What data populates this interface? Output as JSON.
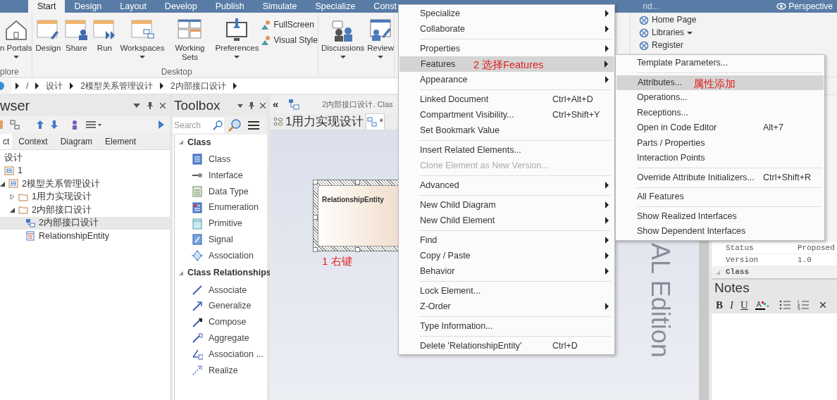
{
  "ribbon": {
    "tabs": [
      {
        "label": "Start",
        "selected": true
      },
      {
        "label": "Design",
        "selected": false
      },
      {
        "label": "Layout",
        "selected": false
      },
      {
        "label": "Develop",
        "selected": false
      },
      {
        "label": "Publish",
        "selected": false
      },
      {
        "label": "Simulate",
        "selected": false
      },
      {
        "label": "Specialize",
        "selected": false
      },
      {
        "label": "Const",
        "selected": false
      }
    ],
    "search": {
      "placeholder": "nd..."
    },
    "perspective": "Perspective",
    "groups": [
      {
        "label": "plore",
        "buttons": [
          {
            "label": "n Portals",
            "dropdown": true
          }
        ]
      },
      {
        "label": "Desktop",
        "buttons": [
          {
            "label": "Design",
            "dropdown": false
          },
          {
            "label": "Share",
            "dropdown": false
          },
          {
            "label": "Run",
            "dropdown": false
          },
          {
            "label": "Workspaces",
            "dropdown": true
          },
          {
            "label": "Working Sets",
            "dropdown": false
          },
          {
            "label": "Preferences",
            "dropdown": true
          }
        ],
        "small": [
          "FullScreen",
          "Visual Style"
        ]
      },
      {
        "buttons": [
          {
            "label": "Discussions",
            "dropdown": true
          },
          {
            "label": "Review",
            "dropdown": true
          }
        ]
      }
    ],
    "links": [
      {
        "label": "Home Page",
        "dropdown": false
      },
      {
        "label": "Libraries",
        "dropdown": true
      },
      {
        "label": "Register",
        "dropdown": false
      }
    ]
  },
  "breadcrumb": [
    "/",
    "设计",
    "2模型关系管理设计",
    "2内部接口设计"
  ],
  "browser": {
    "title": "wser",
    "tabs": [
      {
        "label": "ct",
        "selected": true
      },
      {
        "label": "Context",
        "selected": false
      },
      {
        "label": "Diagram",
        "selected": false
      },
      {
        "label": "Element",
        "selected": false
      }
    ],
    "tree": [
      {
        "label": "设计",
        "kind": "text",
        "selected": false
      },
      {
        "label": "1",
        "kind": "package",
        "selected": false
      },
      {
        "label": "2模型关系管理设计",
        "kind": "package",
        "selected": false,
        "expanded": true,
        "children": [
          {
            "label": "1用力实现设计",
            "kind": "folder",
            "selected": false,
            "expanded": false
          },
          {
            "label": "2内部接口设计",
            "kind": "folder",
            "selected": false,
            "expanded": true,
            "children": [
              {
                "label": "2内部接口设计",
                "kind": "diagram",
                "selected": true
              },
              {
                "label": "RelationshipEntity",
                "kind": "class",
                "selected": false
              }
            ]
          }
        ]
      }
    ]
  },
  "toolbox": {
    "title": "Toolbox",
    "search": {
      "placeholder": "Search"
    },
    "sections": [
      {
        "title": "Class",
        "expanded": true,
        "items": [
          "Class",
          "Interface",
          "Data Type",
          "Enumeration",
          "Primitive",
          "Signal",
          "Association"
        ]
      },
      {
        "title": "Class Relationships",
        "expanded": true,
        "items": [
          "Associate",
          "Generalize",
          "Compose",
          "Aggregate",
          "Association ...",
          "Realize"
        ]
      }
    ]
  },
  "diagram": {
    "collapse": "«",
    "caption": "2内部接口设计. Clas",
    "tabs": [
      {
        "label": "1用力实现设计",
        "selected": false
      },
      {
        "label": "*",
        "selected": true
      }
    ],
    "element": {
      "name": "RelationshipEntity",
      "selected": true
    },
    "annotation": "1 右键",
    "watermark": "AL Edition"
  },
  "context_menu": {
    "items": [
      {
        "kind": "item",
        "label": "Specialize",
        "has_submenu": true,
        "disabled": false,
        "selected": false
      },
      {
        "kind": "item",
        "label": "Collaborate",
        "has_submenu": true,
        "disabled": false,
        "selected": false
      },
      {
        "kind": "separator"
      },
      {
        "kind": "item",
        "label": "Properties",
        "has_submenu": true,
        "disabled": false,
        "selected": false
      },
      {
        "kind": "item",
        "label": "Features",
        "has_submenu": true,
        "disabled": false,
        "selected": true,
        "note": "2 选择Features"
      },
      {
        "kind": "item",
        "label": "Appearance",
        "has_submenu": true,
        "disabled": false,
        "selected": false
      },
      {
        "kind": "separator"
      },
      {
        "kind": "item",
        "label": "Linked Document",
        "shortcut": "Ctrl+Alt+D",
        "has_submenu": false,
        "disabled": false,
        "selected": false
      },
      {
        "kind": "item",
        "label": "Compartment Visibility...",
        "shortcut": "Ctrl+Shift+Y",
        "has_submenu": false,
        "disabled": false,
        "selected": false
      },
      {
        "kind": "item",
        "label": "Set Bookmark Value",
        "has_submenu": false,
        "disabled": false,
        "selected": false
      },
      {
        "kind": "separator"
      },
      {
        "kind": "item",
        "label": "Insert Related Elements...",
        "has_submenu": false,
        "disabled": false,
        "selected": false
      },
      {
        "kind": "item",
        "label": "Clone Element as New Version...",
        "has_submenu": false,
        "disabled": true,
        "selected": false
      },
      {
        "kind": "separator"
      },
      {
        "kind": "item",
        "label": "Advanced",
        "has_submenu": true,
        "disabled": false,
        "selected": false
      },
      {
        "kind": "separator"
      },
      {
        "kind": "item",
        "label": "New Child Diagram",
        "has_submenu": true,
        "disabled": false,
        "selected": false
      },
      {
        "kind": "item",
        "label": "New Child Element",
        "has_submenu": true,
        "disabled": false,
        "selected": false
      },
      {
        "kind": "separator"
      },
      {
        "kind": "item",
        "label": "Find",
        "has_submenu": true,
        "disabled": false,
        "selected": false
      },
      {
        "kind": "item",
        "label": "Copy / Paste",
        "has_submenu": true,
        "disabled": false,
        "selected": false
      },
      {
        "kind": "item",
        "label": "Behavior",
        "has_submenu": true,
        "disabled": false,
        "selected": false
      },
      {
        "kind": "separator"
      },
      {
        "kind": "item",
        "label": "Lock Element...",
        "has_submenu": false,
        "disabled": false,
        "selected": false
      },
      {
        "kind": "item",
        "label": "Z-Order",
        "has_submenu": true,
        "disabled": false,
        "selected": false
      },
      {
        "kind": "separator"
      },
      {
        "kind": "item",
        "label": "Type Information...",
        "has_submenu": false,
        "disabled": false,
        "selected": false
      },
      {
        "kind": "separator"
      },
      {
        "kind": "item",
        "label": "Delete 'RelationshipEntity'",
        "shortcut": "Ctrl+D",
        "has_submenu": false,
        "disabled": false,
        "selected": false
      }
    ]
  },
  "submenu": {
    "items": [
      {
        "kind": "item",
        "label": "Template Parameters...",
        "selected": false
      },
      {
        "kind": "separator"
      },
      {
        "kind": "item",
        "label": "Attributes...",
        "selected": true,
        "note": "属性添加"
      },
      {
        "kind": "item",
        "label": "Operations...",
        "selected": false
      },
      {
        "kind": "item",
        "label": "Receptions...",
        "selected": false
      },
      {
        "kind": "item",
        "label": "Open in Code Editor",
        "shortcut": "Alt+7",
        "selected": false
      },
      {
        "kind": "item",
        "label": "Parts / Properties",
        "selected": false
      },
      {
        "kind": "item",
        "label": "Interaction Points",
        "selected": false
      },
      {
        "kind": "separator"
      },
      {
        "kind": "item",
        "label": "Override Attribute Initializers...",
        "shortcut": "Ctrl+Shift+R",
        "selected": false
      },
      {
        "kind": "separator"
      },
      {
        "kind": "item",
        "label": "All Features",
        "selected": false
      },
      {
        "kind": "separator"
      },
      {
        "kind": "item",
        "label": "Show Realized Interfaces",
        "selected": false
      },
      {
        "kind": "item",
        "label": "Show Dependent Interfaces",
        "selected": false
      }
    ]
  },
  "properties": {
    "rows": [
      {
        "name": "Status",
        "value": "Proposed"
      },
      {
        "name": "Version",
        "value": "1.0"
      }
    ],
    "section": "Class"
  },
  "notes": {
    "title": "Notes",
    "format_buttons": [
      "B",
      "I",
      "U"
    ]
  }
}
